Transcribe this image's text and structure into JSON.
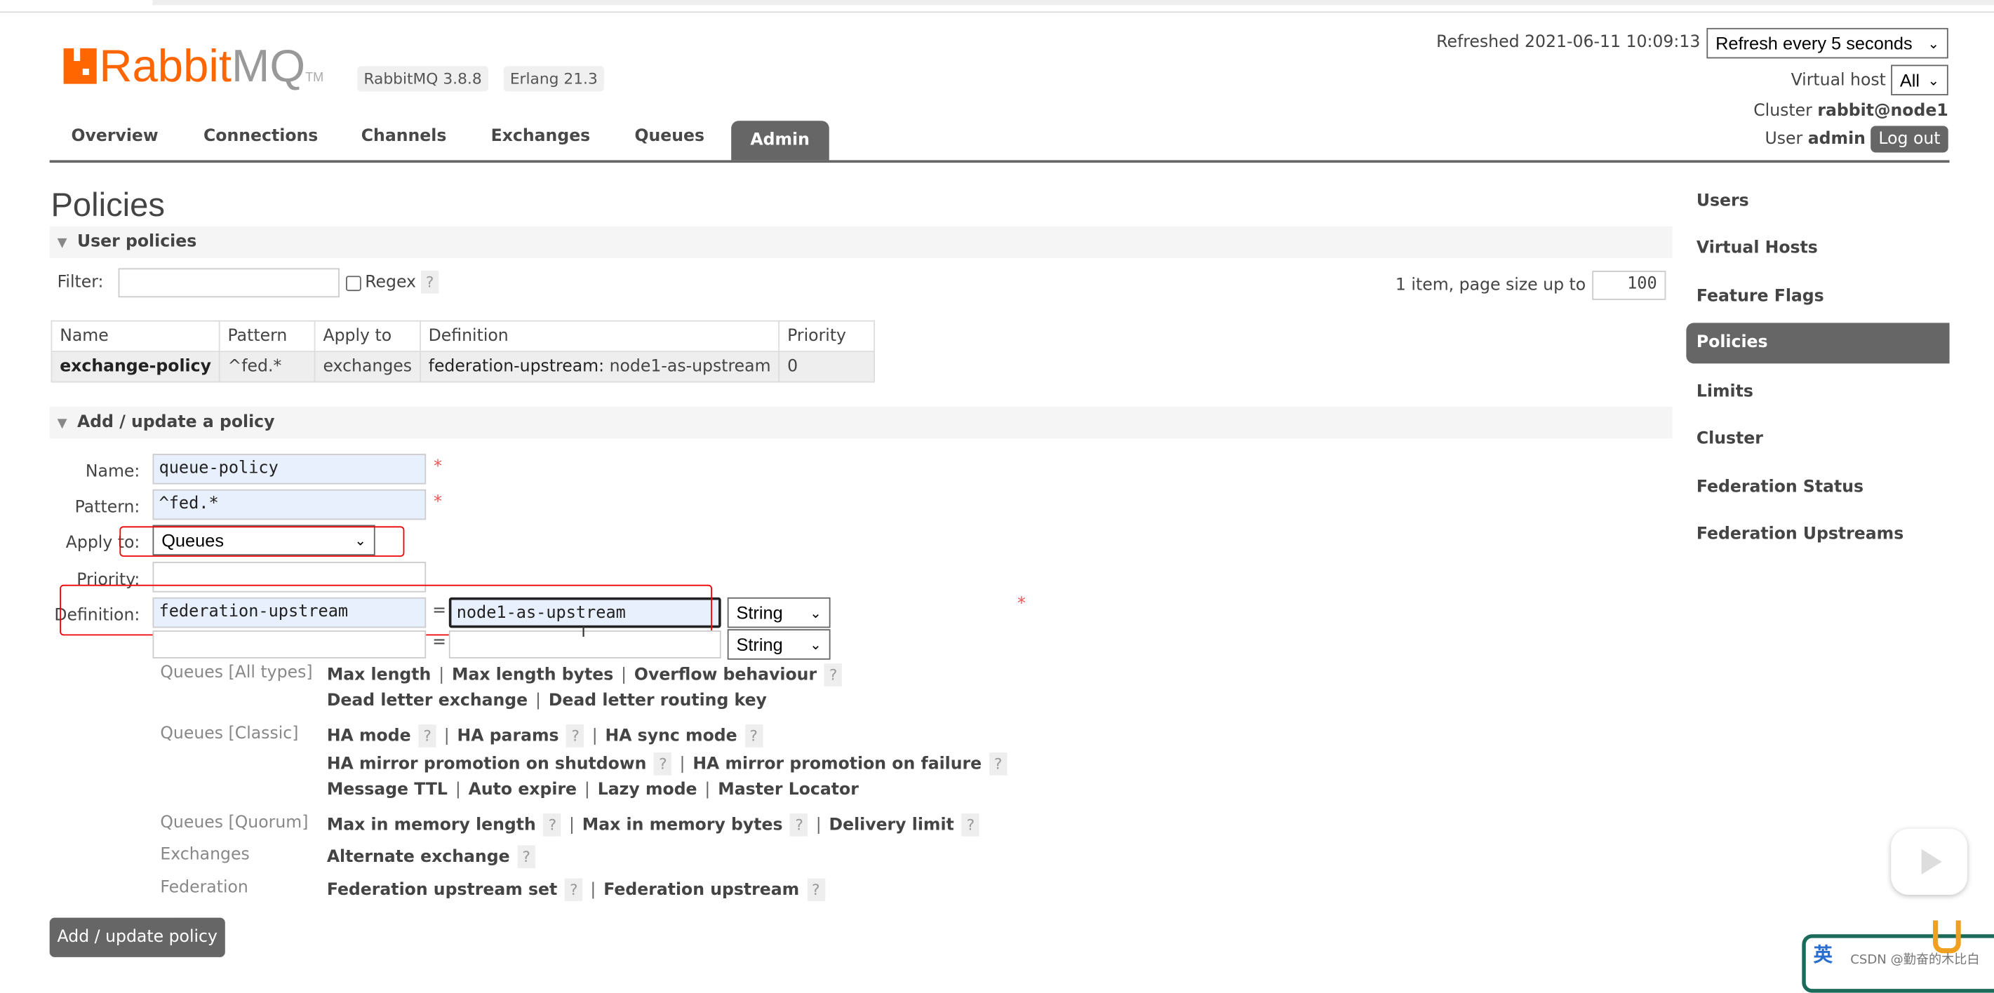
{
  "header": {
    "logo_text": "RabbitMQ",
    "logo_tm": "TM",
    "version_badge": "RabbitMQ 3.8.8",
    "erlang_badge": "Erlang 21.3",
    "refreshed": "Refreshed 2021-06-11 10:09:13",
    "refresh_select": "Refresh every 5 seconds",
    "vhost_label": "Virtual host",
    "vhost_select": "All",
    "cluster_label": "Cluster",
    "cluster_name": "rabbit@node1",
    "user_label": "User",
    "user_name": "admin",
    "logout": "Log out"
  },
  "tabs": [
    {
      "label": "Overview"
    },
    {
      "label": "Connections"
    },
    {
      "label": "Channels"
    },
    {
      "label": "Exchanges"
    },
    {
      "label": "Queues"
    },
    {
      "label": "Admin",
      "active": true
    }
  ],
  "page_title": "Policies",
  "user_policies": {
    "title": "User policies",
    "filter_label": "Filter:",
    "filter_value": "",
    "regex_label": "Regex",
    "help": "?",
    "paging_text": "1 item, page size up to",
    "page_size": "100",
    "columns": [
      "Name",
      "Pattern",
      "Apply to",
      "Definition",
      "Priority"
    ],
    "rows": [
      {
        "name": "exchange-policy",
        "pattern": "^fed.*",
        "apply_to": "exchanges",
        "def_key": "federation-upstream:",
        "def_value": "node1-as-upstream",
        "priority": "0"
      }
    ]
  },
  "add_policy": {
    "title": "Add / update a policy",
    "name_label": "Name:",
    "name_value": "queue-policy",
    "pattern_label": "Pattern:",
    "pattern_value": "^fed.*",
    "apply_label": "Apply to:",
    "apply_value": "Queues",
    "priority_label": "Priority:",
    "priority_value": "",
    "definition_label": "Definition:",
    "def_key": "federation-upstream",
    "def_eq": "=",
    "def_value": "node1-as-upstream",
    "def_type": "String",
    "def2_type": "String",
    "required_mark": "*",
    "help_groups": [
      {
        "category": "Queues [All types]",
        "lines": [
          [
            "Max length",
            "Max length bytes",
            "Overflow behaviour?"
          ],
          [
            "Dead letter exchange",
            "Dead letter routing key"
          ]
        ]
      },
      {
        "category": "Queues [Classic]",
        "lines": [
          [
            "HA mode?",
            "HA params?",
            "HA sync mode?"
          ],
          [
            "HA mirror promotion on shutdown?",
            "HA mirror promotion on failure?"
          ],
          [
            "Message TTL",
            "Auto expire",
            "Lazy mode",
            "Master Locator"
          ]
        ]
      },
      {
        "category": "Queues [Quorum]",
        "lines": [
          [
            "Max in memory length?",
            "Max in memory bytes?",
            "Delivery limit?"
          ]
        ]
      },
      {
        "category": "Exchanges",
        "lines": [
          [
            "Alternate exchange?"
          ]
        ]
      },
      {
        "category": "Federation",
        "lines": [
          [
            "Federation upstream set?",
            "Federation upstream?"
          ]
        ]
      }
    ],
    "submit": "Add / update policy"
  },
  "sidebar": {
    "items": [
      {
        "label": "Users"
      },
      {
        "label": "Virtual Hosts"
      },
      {
        "label": "Feature Flags"
      },
      {
        "label": "Policies",
        "active": true
      },
      {
        "label": "Limits"
      },
      {
        "label": "Cluster"
      },
      {
        "label": "Federation Status"
      },
      {
        "label": "Federation Upstreams"
      }
    ]
  },
  "overlay": {
    "watermark": "CSDN @勤奋的木比白",
    "ime_char": "英",
    "play_icon": "bilibili-tv-icon"
  },
  "colors": {
    "brand": "#ff6600",
    "active_tab": "#666666",
    "highlight_box": "#ee0000",
    "filled_input": "#e8f0fe"
  }
}
